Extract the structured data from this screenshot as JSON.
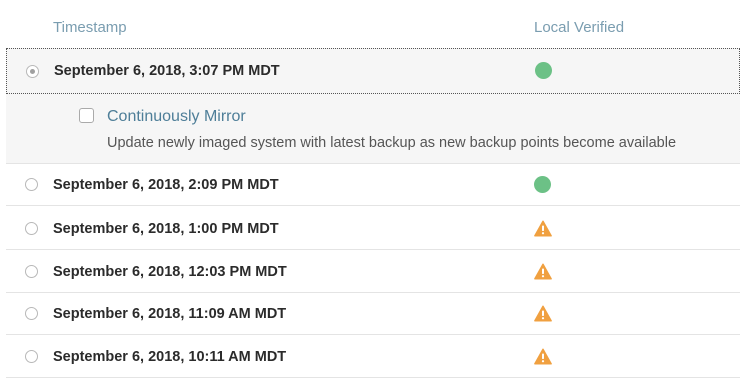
{
  "headers": {
    "timestamp": "Timestamp",
    "local_verified": "Local Verified"
  },
  "selected_row": {
    "timestamp": "September 6, 2018, 3:07 PM MDT",
    "status": "verified-dot-icon",
    "selected": true
  },
  "mirror_option": {
    "label": "Continuously Mirror",
    "checked": false,
    "description": "Update newly imaged system with latest backup as new backup points become available"
  },
  "rows": [
    {
      "timestamp": "September 6, 2018, 2:09 PM MDT",
      "status": "verified-dot-icon"
    },
    {
      "timestamp": "September 6, 2018, 1:00 PM MDT",
      "status": "warning-icon"
    },
    {
      "timestamp": "September 6, 2018, 12:03 PM MDT",
      "status": "warning-icon"
    },
    {
      "timestamp": "September 6, 2018, 11:09 AM MDT",
      "status": "warning-icon"
    },
    {
      "timestamp": "September 6, 2018, 10:11 AM MDT",
      "status": "warning-icon"
    }
  ],
  "colors": {
    "header_text": "#7a9db0",
    "verified": "#6cc186",
    "warning": "#f0a040",
    "accent_label": "#4e7e98"
  }
}
